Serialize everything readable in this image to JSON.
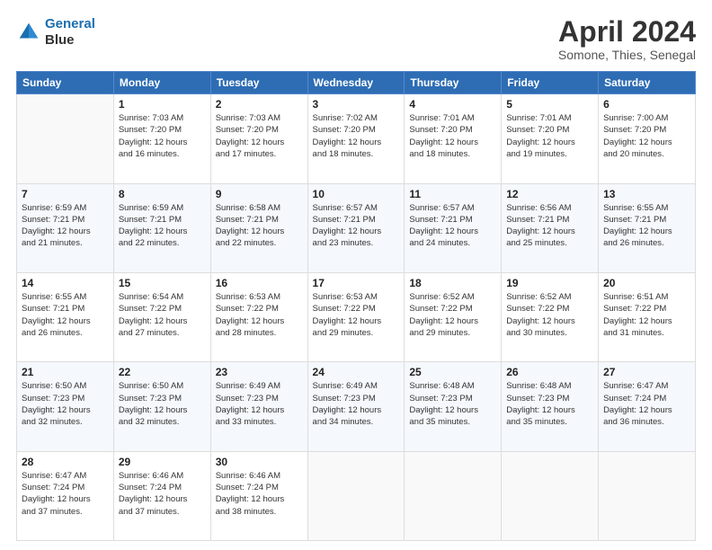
{
  "logo": {
    "line1": "General",
    "line2": "Blue"
  },
  "title": "April 2024",
  "subtitle": "Somone, Thies, Senegal",
  "weekdays": [
    "Sunday",
    "Monday",
    "Tuesday",
    "Wednesday",
    "Thursday",
    "Friday",
    "Saturday"
  ],
  "weeks": [
    [
      {
        "day": "",
        "info": ""
      },
      {
        "day": "1",
        "info": "Sunrise: 7:03 AM\nSunset: 7:20 PM\nDaylight: 12 hours\nand 16 minutes."
      },
      {
        "day": "2",
        "info": "Sunrise: 7:03 AM\nSunset: 7:20 PM\nDaylight: 12 hours\nand 17 minutes."
      },
      {
        "day": "3",
        "info": "Sunrise: 7:02 AM\nSunset: 7:20 PM\nDaylight: 12 hours\nand 18 minutes."
      },
      {
        "day": "4",
        "info": "Sunrise: 7:01 AM\nSunset: 7:20 PM\nDaylight: 12 hours\nand 18 minutes."
      },
      {
        "day": "5",
        "info": "Sunrise: 7:01 AM\nSunset: 7:20 PM\nDaylight: 12 hours\nand 19 minutes."
      },
      {
        "day": "6",
        "info": "Sunrise: 7:00 AM\nSunset: 7:20 PM\nDaylight: 12 hours\nand 20 minutes."
      }
    ],
    [
      {
        "day": "7",
        "info": "Sunrise: 6:59 AM\nSunset: 7:21 PM\nDaylight: 12 hours\nand 21 minutes."
      },
      {
        "day": "8",
        "info": "Sunrise: 6:59 AM\nSunset: 7:21 PM\nDaylight: 12 hours\nand 22 minutes."
      },
      {
        "day": "9",
        "info": "Sunrise: 6:58 AM\nSunset: 7:21 PM\nDaylight: 12 hours\nand 22 minutes."
      },
      {
        "day": "10",
        "info": "Sunrise: 6:57 AM\nSunset: 7:21 PM\nDaylight: 12 hours\nand 23 minutes."
      },
      {
        "day": "11",
        "info": "Sunrise: 6:57 AM\nSunset: 7:21 PM\nDaylight: 12 hours\nand 24 minutes."
      },
      {
        "day": "12",
        "info": "Sunrise: 6:56 AM\nSunset: 7:21 PM\nDaylight: 12 hours\nand 25 minutes."
      },
      {
        "day": "13",
        "info": "Sunrise: 6:55 AM\nSunset: 7:21 PM\nDaylight: 12 hours\nand 26 minutes."
      }
    ],
    [
      {
        "day": "14",
        "info": "Sunrise: 6:55 AM\nSunset: 7:21 PM\nDaylight: 12 hours\nand 26 minutes."
      },
      {
        "day": "15",
        "info": "Sunrise: 6:54 AM\nSunset: 7:22 PM\nDaylight: 12 hours\nand 27 minutes."
      },
      {
        "day": "16",
        "info": "Sunrise: 6:53 AM\nSunset: 7:22 PM\nDaylight: 12 hours\nand 28 minutes."
      },
      {
        "day": "17",
        "info": "Sunrise: 6:53 AM\nSunset: 7:22 PM\nDaylight: 12 hours\nand 29 minutes."
      },
      {
        "day": "18",
        "info": "Sunrise: 6:52 AM\nSunset: 7:22 PM\nDaylight: 12 hours\nand 29 minutes."
      },
      {
        "day": "19",
        "info": "Sunrise: 6:52 AM\nSunset: 7:22 PM\nDaylight: 12 hours\nand 30 minutes."
      },
      {
        "day": "20",
        "info": "Sunrise: 6:51 AM\nSunset: 7:22 PM\nDaylight: 12 hours\nand 31 minutes."
      }
    ],
    [
      {
        "day": "21",
        "info": "Sunrise: 6:50 AM\nSunset: 7:23 PM\nDaylight: 12 hours\nand 32 minutes."
      },
      {
        "day": "22",
        "info": "Sunrise: 6:50 AM\nSunset: 7:23 PM\nDaylight: 12 hours\nand 32 minutes."
      },
      {
        "day": "23",
        "info": "Sunrise: 6:49 AM\nSunset: 7:23 PM\nDaylight: 12 hours\nand 33 minutes."
      },
      {
        "day": "24",
        "info": "Sunrise: 6:49 AM\nSunset: 7:23 PM\nDaylight: 12 hours\nand 34 minutes."
      },
      {
        "day": "25",
        "info": "Sunrise: 6:48 AM\nSunset: 7:23 PM\nDaylight: 12 hours\nand 35 minutes."
      },
      {
        "day": "26",
        "info": "Sunrise: 6:48 AM\nSunset: 7:23 PM\nDaylight: 12 hours\nand 35 minutes."
      },
      {
        "day": "27",
        "info": "Sunrise: 6:47 AM\nSunset: 7:24 PM\nDaylight: 12 hours\nand 36 minutes."
      }
    ],
    [
      {
        "day": "28",
        "info": "Sunrise: 6:47 AM\nSunset: 7:24 PM\nDaylight: 12 hours\nand 37 minutes."
      },
      {
        "day": "29",
        "info": "Sunrise: 6:46 AM\nSunset: 7:24 PM\nDaylight: 12 hours\nand 37 minutes."
      },
      {
        "day": "30",
        "info": "Sunrise: 6:46 AM\nSunset: 7:24 PM\nDaylight: 12 hours\nand 38 minutes."
      },
      {
        "day": "",
        "info": ""
      },
      {
        "day": "",
        "info": ""
      },
      {
        "day": "",
        "info": ""
      },
      {
        "day": "",
        "info": ""
      }
    ]
  ]
}
